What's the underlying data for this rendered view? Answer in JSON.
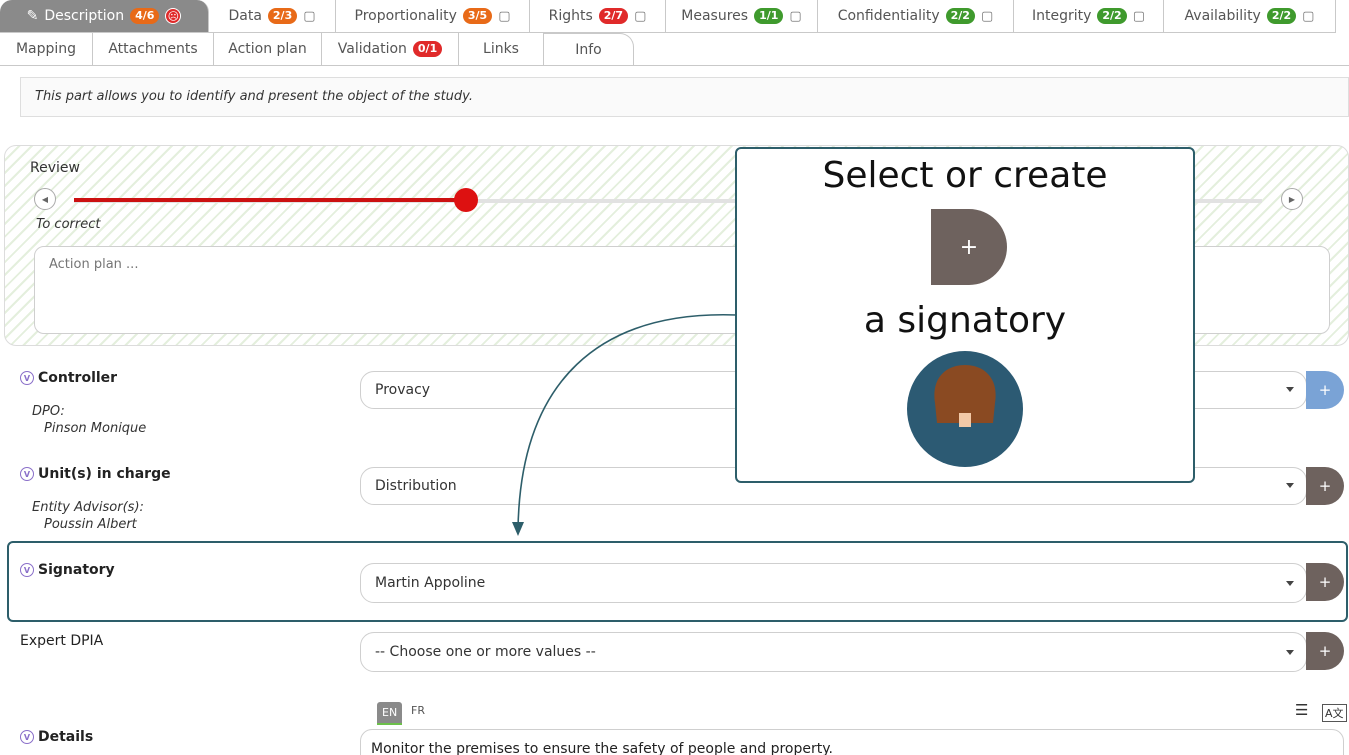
{
  "tabs_row1": [
    {
      "label": "Description",
      "badge": "4/6",
      "badge_color": "#e86a18",
      "active": true
    },
    {
      "label": "Data",
      "badge": "2/3",
      "badge_color": "#e86a18"
    },
    {
      "label": "Proportionality",
      "badge": "3/5",
      "badge_color": "#e86a18"
    },
    {
      "label": "Rights",
      "badge": "2/7",
      "badge_color": "#e02a2a"
    },
    {
      "label": "Measures",
      "badge": "1/1",
      "badge_color": "#3f9a2d"
    },
    {
      "label": "Confidentiality",
      "badge": "2/2",
      "badge_color": "#3f9a2d"
    },
    {
      "label": "Integrity",
      "badge": "2/2",
      "badge_color": "#3f9a2d"
    },
    {
      "label": "Availability",
      "badge": "2/2",
      "badge_color": "#3f9a2d"
    }
  ],
  "tabs_row2": [
    {
      "label": "Mapping"
    },
    {
      "label": "Attachments"
    },
    {
      "label": "Action plan"
    },
    {
      "label": "Validation",
      "badge": "0/1",
      "badge_color": "#e02a2a"
    },
    {
      "label": "Links"
    },
    {
      "label": "Info"
    }
  ],
  "info_text": "This part allows you to identify and present the object of the study.",
  "review": {
    "label": "Review",
    "status": "To correct",
    "progress": 0.33,
    "action_plan_placeholder": "Action plan ..."
  },
  "controller": {
    "label": "Controller",
    "sub_label": "DPO:",
    "sub_value": "Pinson Monique",
    "value": "Provacy"
  },
  "units": {
    "label": "Unit(s) in charge",
    "sub_label": "Entity Advisor(s):",
    "sub_value": "Poussin Albert",
    "value": "Distribution"
  },
  "signatory": {
    "label": "Signatory",
    "value": "Martin Appoline"
  },
  "expert": {
    "label": "Expert DPIA",
    "value": "-- Choose one or more values --"
  },
  "details": {
    "label": "Details",
    "lang_en": "EN",
    "lang_fr": "FR",
    "value": "Monitor the premises to ensure the safety of people and property."
  },
  "callout": {
    "title": "Select or create",
    "subtitle": "a signatory"
  },
  "buttons": {
    "add": "+"
  },
  "colors": {
    "accent_teal": "#2d5e6a",
    "add_button": "#6e625e",
    "slider_red": "#dd1111"
  }
}
